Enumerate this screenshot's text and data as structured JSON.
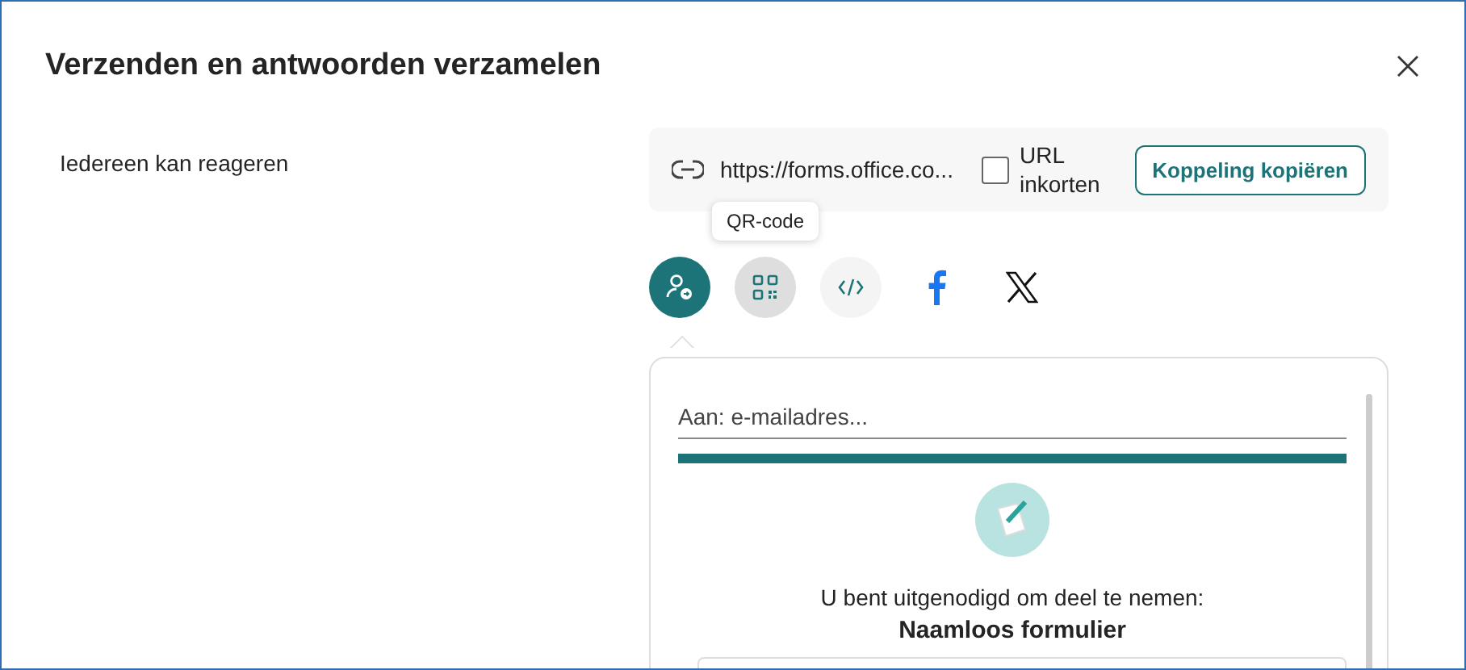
{
  "dialog": {
    "title": "Verzenden en antwoorden verzamelen"
  },
  "audience": {
    "label": "Iedereen kan reageren"
  },
  "link": {
    "url": "https://forms.office.co...",
    "shorten": {
      "label": "URL inkorten",
      "checked": false
    },
    "copy_button": "Koppeling kopiëren"
  },
  "share_options": [
    {
      "kind": "invite",
      "selected": true,
      "hovered": false
    },
    {
      "kind": "qr",
      "selected": false,
      "hovered": true,
      "tooltip": "QR-code"
    },
    {
      "kind": "embed",
      "selected": false,
      "hovered": false
    },
    {
      "kind": "facebook",
      "selected": false,
      "hovered": false
    },
    {
      "kind": "x",
      "selected": false,
      "hovered": false
    }
  ],
  "email": {
    "placeholder": "Aan: e-mailadres..."
  },
  "preview": {
    "invitation": "U bent uitgenodigd om deel te nemen:",
    "form_title": "Naamloos formulier"
  }
}
